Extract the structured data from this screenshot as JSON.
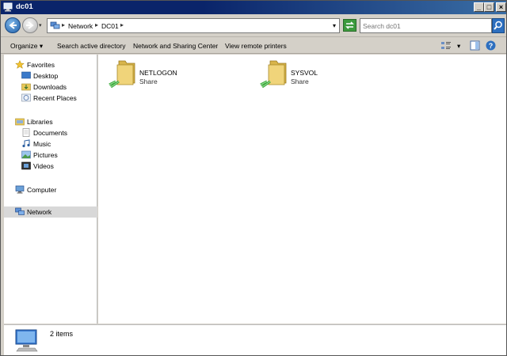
{
  "window": {
    "title": "dc01"
  },
  "titlebar_buttons": {
    "minimize": "_",
    "maximize": "□",
    "close": "×"
  },
  "address": {
    "crumbs": [
      "Network",
      "DC01"
    ],
    "search_placeholder": "Search dc01"
  },
  "commands": [
    {
      "label": "Organize ▾"
    },
    {
      "label": "Search active directory"
    },
    {
      "label": "Network and Sharing Center"
    },
    {
      "label": "View remote printers"
    }
  ],
  "navigation": {
    "favorites": {
      "label": "Favorites",
      "items": [
        "Desktop",
        "Downloads",
        "Recent Places"
      ]
    },
    "libraries": {
      "label": "Libraries",
      "items": [
        "Documents",
        "Music",
        "Pictures",
        "Videos"
      ]
    },
    "computer": "Computer",
    "network": "Network"
  },
  "shares": [
    {
      "name": "NETLOGON",
      "type": "Share"
    },
    {
      "name": "SYSVOL",
      "type": "Share"
    }
  ],
  "details": {
    "count": "2 items"
  },
  "colors": {
    "titlebar": "#0a246a",
    "selected_nav": "#d8d8d8",
    "folder": "#e8c85a",
    "share_pipe": "#3aa63a"
  }
}
